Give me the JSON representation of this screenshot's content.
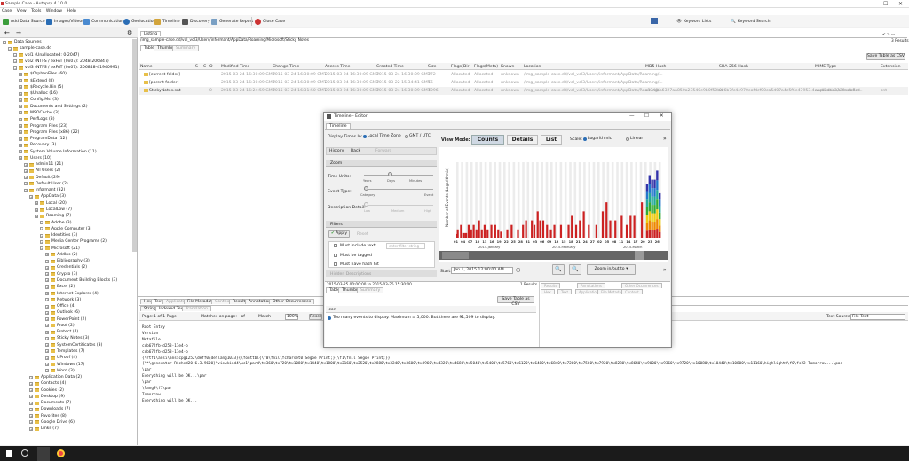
{
  "window": {
    "title": "Sample Case - Autopsy 4.10.0",
    "controls": [
      "—",
      "☐",
      "✕"
    ]
  },
  "menu": [
    "Case",
    "View",
    "Tools",
    "Window",
    "Help"
  ],
  "toolbar": {
    "add_data_source": "Add Data Source",
    "images_videos": "Images/Videos",
    "communications": "Communications",
    "geolocation": "Geolocation",
    "timeline": "Timeline",
    "discovery": "Discovery",
    "generate_report": "Generate Report",
    "close_case": "Close Case",
    "keyword_lists": "Keyword Lists",
    "keyword_search": "Keyword Search"
  },
  "tree": {
    "items": [
      "Data Sources",
      "sample-case.dd",
      "vol1 (Unallocated: 0-2047)",
      "vol2 (NTFS / exFAT (0x07): 2048-206847)",
      "vol3 (NTFS / exFAT (0x07): 206848-41940991)",
      "$OrphanFiles (60)",
      "$Extend (8)",
      "$Recycle.Bin (5)",
      "$Unalloc (16)",
      "Config.Msi (3)",
      "Documents and Settings (2)",
      "MSOCache (3)",
      "PerfLogs (3)",
      "Program Files (23)",
      "Program Files (x86) (22)",
      "ProgramData (12)",
      "Recovery (3)",
      "System Volume Information (11)",
      "Users (10)",
      "admin11 (21)",
      "All Users (2)",
      "Default (29)",
      "Default User (2)",
      "informant (32)",
      "AppData (3)",
      "Local (20)",
      "LocalLow (7)",
      "Roaming (7)",
      "Adobe (3)",
      "Apple Computer (3)",
      "Identities (3)",
      "Media Center Programs (2)",
      "Microsoft (21)",
      "AddIns (2)",
      "Bibliography (3)",
      "Credentials (2)",
      "Crypto (3)",
      "Document Building Blocks (3)",
      "Excel (2)",
      "Internet Explorer (4)",
      "Network (3)",
      "Office (4)",
      "Outlook (6)",
      "PowerPoint (2)",
      "Proof (2)",
      "Protect (4)",
      "Sticky Notes (3)",
      "SystemCertificates (3)",
      "Templates (7)",
      "UProof (4)",
      "Windows (17)",
      "Word (3)",
      "Application Data (2)",
      "Contacts (4)",
      "Cookies (2)",
      "Desktop (9)",
      "Documents (7)",
      "Downloads (7)",
      "Favorites (8)",
      "Google Drive (6)",
      "Links (7)"
    ]
  },
  "listing": {
    "tab": "Listing",
    "path": "/img_sample-case.dd/vol_vol3/Users/informant/AppData/Roaming/Microsoft/Sticky Notes",
    "subtabs": [
      "Table",
      "Thumbnail",
      "Summary"
    ],
    "results": "3 Results",
    "save_csv": "Save Table as CSV",
    "columns": [
      "Name",
      "S",
      "C",
      "O",
      "Modified Time",
      "Change Time",
      "Access Time",
      "Created Time",
      "Size",
      "Flags(Dir)",
      "Flags(Meta)",
      "Known",
      "Location",
      "MD5 Hash",
      "SHA-256 Hash",
      "MIME Type",
      "Extension"
    ],
    "rows": [
      [
        "[current folder]",
        "",
        "",
        "",
        "2015-03-24 16:30:09 GMT",
        "2015-03-24 16:30:09 GMT",
        "2015-03-24 16:30:09 GMT",
        "2015-03-24 16:30:09 GMT",
        "272",
        "Allocated",
        "Allocated",
        "unknown",
        "/img_sample-case.dd/vol_vol3/Users/informant/AppData/Roaming/...",
        "",
        "",
        "",
        ""
      ],
      [
        "[parent folder]",
        "",
        "",
        "",
        "2015-03-24 16:30:09 GMT",
        "2015-03-24 16:30:09 GMT",
        "2015-03-24 16:30:09 GMT",
        "2015-03-22 15:34:41 GMT",
        "56",
        "Allocated",
        "Allocated",
        "unknown",
        "/img_sample-case.dd/vol_vol3/Users/informant/AppData/Roaming/...",
        "",
        "",
        "",
        ""
      ],
      [
        "StickyNotes.snt",
        "",
        "",
        "0",
        "2015-03-24 16:24:59 GMT",
        "2015-03-24 16:31:50 GMT",
        "2015-03-24 16:30:09 GMT",
        "2015-03-24 16:30:09 GMT",
        "4096",
        "Allocated",
        "Allocated",
        "unknown",
        "/img_sample-case.dd/vol_vol3/Users/informant/AppData/Roaming/...",
        "c334fbe6327aa850a23540e9b0f50bd",
        "0c6b7fc4e970eafdcf00ca5d07a4c5f6e47953.4cacb0dbe2330edb8cd..",
        "application/x-ms-ofice",
        "snt"
      ]
    ]
  },
  "text_viewer": {
    "tabs": [
      "Hex",
      "Text",
      "Application",
      "File Metadata",
      "Context",
      "Results",
      "Annotations",
      "Other Occurrences"
    ],
    "subtabs": [
      "Strings",
      "Indexed Text",
      "Translation"
    ],
    "page": "Page:",
    "page_val": "1 of 1 Page",
    "matches": "Matches on page: - of -",
    "match": "Match",
    "zoom": "100%",
    "reset": "Reset",
    "text_source": "Text Source:",
    "text_source_val": "File Text",
    "lines": [
      "Root Entry",
      "Version",
      "Metafile",
      "ccb672fb-d253-11e4-b",
      "ccb672fb-d253-11e4-b",
      "{\\rtf1\\ansi\\ansicpg1252\\deff0\\deflang1033}{\\fonttbl{\\f0\\fnil\\fcharset0 Segoe Print;}{\\f1\\fnil Segoe Print;}}",
      "{\\*\\generator Riched20 6.3.9600}\\viewkind4\\uc1\\pard\\tx360\\tx720\\tx1080\\tx1440\\tx1800\\tx2160\\tx2520\\tx2880\\tx3240\\tx3600\\tx3960\\tx4320\\tx4680\\tx5040\\tx5400\\tx5760\\tx6120\\tx6480\\tx6840\\tx7200\\tx7560\\tx7920\\tx8280\\tx8640\\tx9000\\tx9360\\tx9720\\tx10080\\tx10440\\tx10800\\tx11160\\highlight0\\f0\\fs22 Tomorrow...\\par",
      "\\par",
      "Everything will be OK...\\par",
      "\\par",
      "\\lang9\\f1\\par",
      "Tomorrow...",
      "Everything will be OK..."
    ]
  },
  "timeline": {
    "title": "Timeline - Editor",
    "tab": "Timeline",
    "display_times_in": "Display Times In:",
    "local_tz": "Local Time Zone",
    "gmt": "GMT / UTC",
    "history": "History",
    "back": "Back",
    "forward": "Forward",
    "zoom": "Zoom",
    "time_units": "Time Units:",
    "tu_labels": [
      "Years",
      "Days",
      "Minutes"
    ],
    "event_type": "Event Type:",
    "et_labels": [
      "Category",
      "Event"
    ],
    "desc_detail": "Description Detail:",
    "dd_labels": [
      "Low",
      "Medium",
      "High"
    ],
    "filters": "Filters",
    "apply": "Apply",
    "reset": "Reset",
    "must_include": "Must include text:",
    "enter_filter": "enter filter string",
    "must_be_tagged": "Must be tagged",
    "must_have_hash": "Must have hash hit",
    "hidden_desc": "Hidden Descriptions",
    "view_mode": "View Mode:",
    "counts": "Counts",
    "details": "Details",
    "list": "List",
    "scale": "Scale:",
    "logarithmic": "Logarithmic",
    "linear": "Linear",
    "ylabel": "Number of Events (Logarithmic)",
    "dates": [
      "01",
      "04",
      "07",
      "10",
      "13",
      "16",
      "19",
      "22",
      "25",
      "28",
      "31",
      "03",
      "06",
      "09",
      "12",
      "15",
      "18",
      "21",
      "24",
      "27",
      "02",
      "05",
      "08",
      "11",
      "14",
      "17",
      "20",
      "23",
      "26"
    ],
    "months": [
      "2015-January",
      "2015-February",
      "2015-March"
    ],
    "start": "Start:",
    "start_val": "Jan 1, 2015 12:00:00 AM",
    "zoom_in_out": "Zoom in/out to",
    "range": "2015-03-25 00:00:00 to 2015-03-25 15:30:00",
    "results": "1 Results",
    "subtabs": [
      "Table",
      "Thumbnail",
      "Summary"
    ],
    "save_csv": "Save Table as CSV",
    "rtabs": [
      "Results",
      "Annotations",
      "Other Occurrences",
      "Hex",
      "Text",
      "Application",
      "File Metadata",
      "Context"
    ],
    "icon_col": "Icon",
    "msg": "Too many events to display. Maximum = 5,000. But there are 91,509 to display.",
    "chart_data": {
      "type": "bar",
      "bars": [
        [
          0,
          1
        ],
        [
          0.2,
          2
        ],
        [
          1.5,
          3
        ],
        [
          2.7,
          1.2
        ],
        [
          3.5,
          1.2
        ],
        [
          4.5,
          3
        ],
        [
          5.5,
          2
        ],
        [
          6.5,
          3
        ],
        [
          7.6,
          2
        ],
        [
          8.6,
          4
        ],
        [
          9.7,
          2
        ],
        [
          10.8,
          3
        ],
        [
          12,
          2
        ],
        [
          13.5,
          3
        ],
        [
          15,
          3
        ],
        [
          16.2,
          2
        ],
        [
          17.3,
          1.5
        ],
        [
          19.8,
          2
        ],
        [
          21.5,
          3
        ],
        [
          24,
          2
        ],
        [
          26,
          3
        ],
        [
          27.2,
          4
        ],
        [
          29.5,
          4
        ],
        [
          30.5,
          3
        ],
        [
          31.8,
          6
        ],
        [
          32.8,
          4
        ],
        [
          34,
          4
        ],
        [
          35.5,
          3
        ],
        [
          37,
          2
        ],
        [
          38.4,
          3
        ],
        [
          41,
          3
        ],
        [
          44,
          3
        ],
        [
          45.3,
          5
        ],
        [
          47,
          3
        ],
        [
          48.5,
          4
        ],
        [
          50,
          6
        ],
        [
          52,
          3
        ],
        [
          55,
          3
        ],
        [
          57.5,
          6
        ],
        [
          59,
          8
        ],
        [
          60.5,
          4
        ],
        [
          62.5,
          4
        ],
        [
          65,
          5
        ],
        [
          67,
          3
        ],
        [
          68.5,
          5
        ],
        [
          70,
          5
        ],
        [
          73,
          8
        ],
        [
          75,
          12
        ],
        [
          76,
          14
        ],
        [
          77,
          13
        ],
        [
          78,
          13
        ],
        [
          79,
          15
        ],
        [
          80,
          10
        ]
      ]
    }
  }
}
